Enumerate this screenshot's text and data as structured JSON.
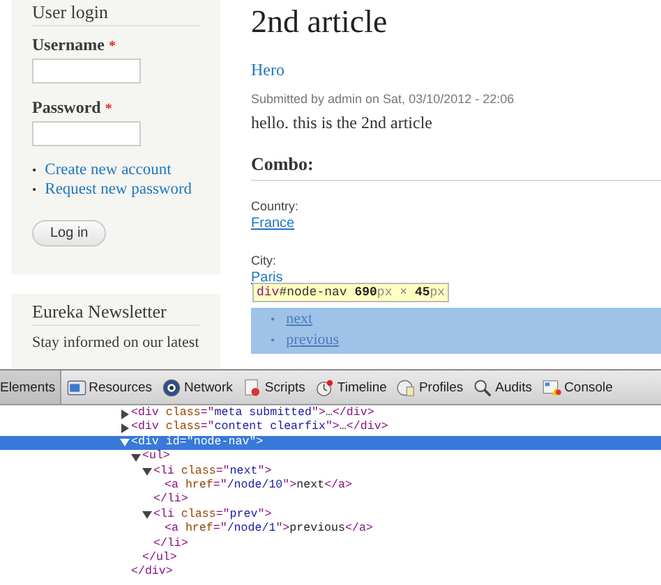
{
  "sidebar": {
    "blocks": [
      {
        "kind": "login",
        "title": "User login",
        "fields": [
          {
            "label": "Username",
            "required": "*"
          },
          {
            "label": "Password",
            "required": "*"
          }
        ],
        "marker": "•",
        "links": [
          "Create new account",
          "Request new password"
        ],
        "button": "Log in"
      },
      {
        "kind": "newsletter",
        "title": "Eureka Newsletter",
        "text": "Stay informed on our latest"
      }
    ]
  },
  "article": {
    "title": "2nd article",
    "tag": "Hero",
    "submitted": "Submitted by admin on Sat, 03/10/2012 - 22:06",
    "body": "hello. this is the 2nd article",
    "group": "Combo:",
    "fields": [
      {
        "label": "Country:",
        "value": "France"
      },
      {
        "label": "City:",
        "value": "Paris"
      }
    ],
    "inspect_tooltip": [
      {
        "kind": "tag",
        "text": "div"
      },
      {
        "kind": "id",
        "text": "#node-nav "
      },
      {
        "kind": "number",
        "text": "690"
      },
      {
        "kind": "unit",
        "text": "px × "
      },
      {
        "kind": "number",
        "text": "45"
      },
      {
        "kind": "unit",
        "text": "px"
      }
    ],
    "nav_marker": "•",
    "nav": [
      "next",
      "previous"
    ]
  },
  "devtools": {
    "tabs": [
      {
        "label": "Elements",
        "selected": true
      },
      {
        "label": "Resources",
        "selected": false
      },
      {
        "label": "Network",
        "selected": false
      },
      {
        "label": "Scripts",
        "selected": false
      },
      {
        "label": "Timeline",
        "selected": false
      },
      {
        "label": "Profiles",
        "selected": false
      },
      {
        "label": "Audits",
        "selected": false
      },
      {
        "label": "Console",
        "selected": false
      }
    ],
    "tree": [
      {
        "line": [
          {
            "kind": "tag",
            "text": "<div "
          },
          {
            "kind": "attr",
            "text": "class"
          },
          {
            "kind": "tag",
            "text": "=\""
          },
          {
            "kind": "value",
            "text": "meta submitted"
          },
          {
            "kind": "tag",
            "text": "\">"
          },
          {
            "kind": "text",
            "text": "…"
          },
          {
            "kind": "tag",
            "text": "</div>"
          }
        ],
        "expanded": false,
        "selected": false
      },
      {
        "line": [
          {
            "kind": "tag",
            "text": "<div "
          },
          {
            "kind": "attr",
            "text": "class"
          },
          {
            "kind": "tag",
            "text": "=\""
          },
          {
            "kind": "value",
            "text": "content clearfix"
          },
          {
            "kind": "tag",
            "text": "\">"
          },
          {
            "kind": "text",
            "text": "…"
          },
          {
            "kind": "tag",
            "text": "</div>"
          }
        ],
        "expanded": false,
        "selected": false
      },
      {
        "line": [
          {
            "kind": "tag",
            "text": "<div "
          },
          {
            "kind": "attr",
            "text": "id"
          },
          {
            "kind": "tag",
            "text": "=\""
          },
          {
            "kind": "value",
            "text": "node-nav"
          },
          {
            "kind": "tag",
            "text": "\">"
          }
        ],
        "expanded": true,
        "selected": true,
        "close": [
          {
            "kind": "tag",
            "text": "</div>"
          }
        ],
        "children": [
          {
            "line": [
              {
                "kind": "tag",
                "text": "<ul>"
              }
            ],
            "expanded": true,
            "selected": false,
            "close": [
              {
                "kind": "tag",
                "text": "</ul>"
              }
            ],
            "children": [
              {
                "line": [
                  {
                    "kind": "tag",
                    "text": "<li "
                  },
                  {
                    "kind": "attr",
                    "text": "class"
                  },
                  {
                    "kind": "tag",
                    "text": "=\""
                  },
                  {
                    "kind": "value",
                    "text": "next"
                  },
                  {
                    "kind": "tag",
                    "text": "\">"
                  }
                ],
                "expanded": true,
                "selected": false,
                "close": [
                  {
                    "kind": "tag",
                    "text": "</li>"
                  }
                ],
                "children": [
                  {
                    "line": [
                      {
                        "kind": "tag",
                        "text": "<a "
                      },
                      {
                        "kind": "attr",
                        "text": "href"
                      },
                      {
                        "kind": "tag",
                        "text": "=\""
                      },
                      {
                        "kind": "value",
                        "text": "/node/10"
                      },
                      {
                        "kind": "tag",
                        "text": "\">"
                      },
                      {
                        "kind": "text",
                        "text": "next"
                      },
                      {
                        "kind": "tag",
                        "text": "</a>"
                      }
                    ],
                    "selected": false
                  }
                ]
              },
              {
                "line": [
                  {
                    "kind": "tag",
                    "text": "<li "
                  },
                  {
                    "kind": "attr",
                    "text": "class"
                  },
                  {
                    "kind": "tag",
                    "text": "=\""
                  },
                  {
                    "kind": "value",
                    "text": "prev"
                  },
                  {
                    "kind": "tag",
                    "text": "\">"
                  }
                ],
                "expanded": true,
                "selected": false,
                "close": [
                  {
                    "kind": "tag",
                    "text": "</li>"
                  }
                ],
                "children": [
                  {
                    "line": [
                      {
                        "kind": "tag",
                        "text": "<a "
                      },
                      {
                        "kind": "attr",
                        "text": "href"
                      },
                      {
                        "kind": "tag",
                        "text": "=\""
                      },
                      {
                        "kind": "value",
                        "text": "/node/1"
                      },
                      {
                        "kind": "tag",
                        "text": "\">"
                      },
                      {
                        "kind": "text",
                        "text": "previous"
                      },
                      {
                        "kind": "tag",
                        "text": "</a>"
                      }
                    ],
                    "selected": false
                  }
                ]
              }
            ]
          }
        ]
      }
    ]
  }
}
